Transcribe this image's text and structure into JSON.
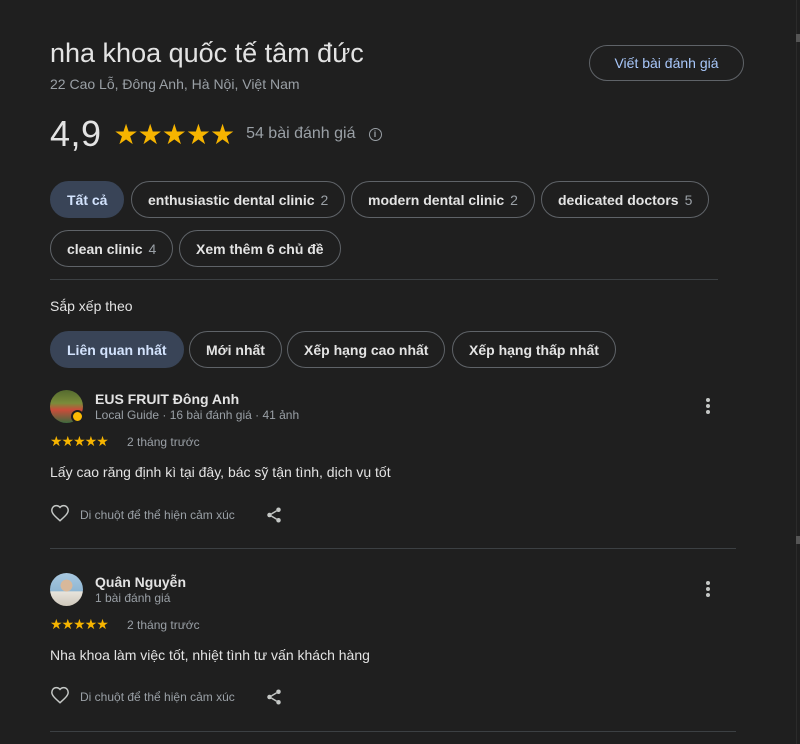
{
  "place": {
    "name": "nha khoa quốc tế tâm đức",
    "address": "22 Cao Lỗ, Đông Anh, Hà Nội, Việt Nam",
    "write_review_label": "Viết bài đánh giá"
  },
  "rating": {
    "value": "4,9",
    "stars": "★★★★★",
    "review_count_label": "54 bài đánh giá",
    "info_icon": "i"
  },
  "topics": [
    {
      "label": "Tất cả",
      "count": "",
      "active": true
    },
    {
      "label": "enthusiastic dental clinic",
      "count": "2"
    },
    {
      "label": "modern dental clinic",
      "count": "2"
    },
    {
      "label": "dedicated doctors",
      "count": "5"
    },
    {
      "label": "clean clinic",
      "count": "4"
    },
    {
      "label": "Xem thêm 6 chủ đề",
      "count": ""
    }
  ],
  "sort": {
    "label": "Sắp xếp theo",
    "options": [
      {
        "label": "Liên quan nhất",
        "active": true
      },
      {
        "label": "Mới nhất"
      },
      {
        "label": "Xếp hạng cao nhất"
      },
      {
        "label": "Xếp hạng thấp nhất"
      }
    ]
  },
  "reviews": [
    {
      "name": "EUS FRUIT Đông Anh",
      "meta": "Local Guide · 16 bài đánh giá · 41 ảnh",
      "stars": "★★★★★",
      "time": "2 tháng trước",
      "text": "Lấy cao răng định kì tại đây, bác sỹ tận tình, dịch vụ tốt",
      "react_label": "Di chuột để thể hiện cảm xúc"
    },
    {
      "name": "Quân Nguyễn",
      "meta": "1 bài đánh giá",
      "stars": "★★★★★",
      "time": "2 tháng trước",
      "text": "Nha khoa làm việc tốt, nhiệt tình tư vấn khách hàng",
      "react_label": "Di chuột để thể hiện cảm xúc"
    }
  ],
  "colors": {
    "background": "#1f1f1f",
    "star": "#f6b400",
    "accent_chip": "#394457",
    "link": "#a8c7fa"
  },
  "icons": {
    "info": "info-icon",
    "more": "more-vert-icon",
    "heart": "heart-outline-icon",
    "share": "share-icon"
  }
}
